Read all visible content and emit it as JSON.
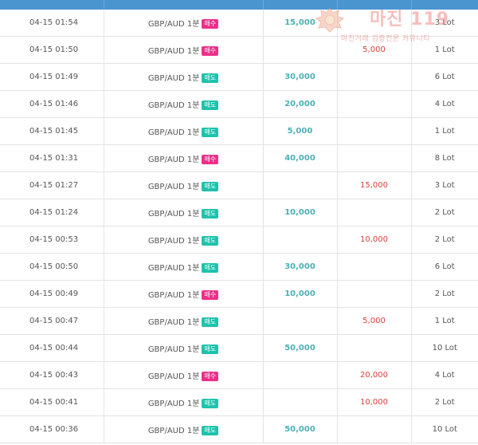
{
  "trades": [
    {
      "time": "04-15 01:54",
      "item": "GBP/AUD 1분",
      "side": "매수",
      "side_type": "buy",
      "profit": "15,000",
      "loss": "",
      "qty": "3 Lot"
    },
    {
      "time": "04-15 01:50",
      "item": "GBP/AUD 1분",
      "side": "매수",
      "side_type": "buy",
      "profit": "",
      "loss": "5,000",
      "qty": "1 Lot"
    },
    {
      "time": "04-15 01:49",
      "item": "GBP/AUD 1분",
      "side": "매도",
      "side_type": "sell",
      "profit": "30,000",
      "loss": "",
      "qty": "6 Lot"
    },
    {
      "time": "04-15 01:46",
      "item": "GBP/AUD 1분",
      "side": "매도",
      "side_type": "sell",
      "profit": "20,000",
      "loss": "",
      "qty": "4 Lot"
    },
    {
      "time": "04-15 01:45",
      "item": "GBP/AUD 1분",
      "side": "매도",
      "side_type": "sell",
      "profit": "5,000",
      "loss": "",
      "qty": "1 Lot"
    },
    {
      "time": "04-15 01:31",
      "item": "GBP/AUD 1분",
      "side": "매수",
      "side_type": "buy",
      "profit": "40,000",
      "loss": "",
      "qty": "8 Lot"
    },
    {
      "time": "04-15 01:27",
      "item": "GBP/AUD 1분",
      "side": "매도",
      "side_type": "sell",
      "profit": "",
      "loss": "15,000",
      "qty": "3 Lot"
    },
    {
      "time": "04-15 01:24",
      "item": "GBP/AUD 1분",
      "side": "매도",
      "side_type": "sell",
      "profit": "10,000",
      "loss": "",
      "qty": "2 Lot"
    },
    {
      "time": "04-15 00:53",
      "item": "GBP/AUD 1분",
      "side": "매도",
      "side_type": "sell",
      "profit": "",
      "loss": "10,000",
      "qty": "2 Lot"
    },
    {
      "time": "04-15 00:50",
      "item": "GBP/AUD 1분",
      "side": "매도",
      "side_type": "sell",
      "profit": "30,000",
      "loss": "",
      "qty": "6 Lot"
    },
    {
      "time": "04-15 00:49",
      "item": "GBP/AUD 1분",
      "side": "매수",
      "side_type": "buy",
      "profit": "10,000",
      "loss": "",
      "qty": "2 Lot"
    },
    {
      "time": "04-15 00:47",
      "item": "GBP/AUD 1분",
      "side": "매도",
      "side_type": "sell",
      "profit": "",
      "loss": "5,000",
      "qty": "1 Lot"
    },
    {
      "time": "04-15 00:44",
      "item": "GBP/AUD 1분",
      "side": "매도",
      "side_type": "sell",
      "profit": "50,000",
      "loss": "",
      "qty": "10 Lot"
    },
    {
      "time": "04-15 00:43",
      "item": "GBP/AUD 1분",
      "side": "매수",
      "side_type": "buy",
      "profit": "",
      "loss": "20,000",
      "qty": "4 Lot"
    },
    {
      "time": "04-15 00:41",
      "item": "GBP/AUD 1분",
      "side": "매도",
      "side_type": "sell",
      "profit": "",
      "loss": "10,000",
      "qty": "2 Lot"
    },
    {
      "time": "04-15 00:36",
      "item": "GBP/AUD 1분",
      "side": "매도",
      "side_type": "sell",
      "profit": "50,000",
      "loss": "",
      "qty": "10 Lot"
    }
  ],
  "watermark": {
    "brand": "마진 119",
    "subtitle": "마진거래 검증전문 커뮤니티"
  },
  "colors": {
    "header": "#4a94d0",
    "buy_badge": "#ee2f8a",
    "sell_badge": "#1fc2ad",
    "profit": "#4bb0b4",
    "loss": "#d8403c"
  }
}
